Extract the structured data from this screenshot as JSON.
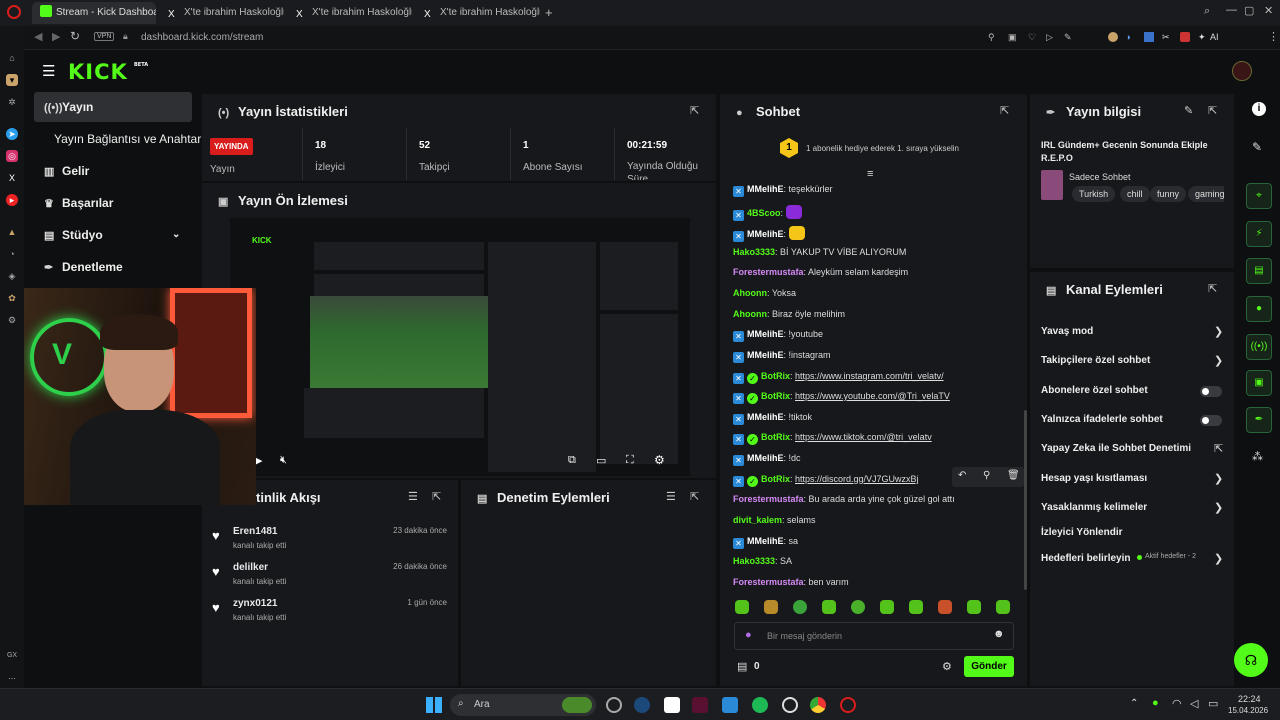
{
  "browser": {
    "tabs": [
      "Stream - Kick Dashboard",
      "X'te ibrahim Haskoloğlu: '",
      "X'te ibrahim Haskoloğlu: '",
      "X'te ibrahim Haskoloğlu: '"
    ],
    "new_tab": "+",
    "vpn": "VPN",
    "url": "dashboard.kick.com/stream",
    "ai": "AI"
  },
  "side_bar_bottom": {
    "gx": "GX",
    "more": "..."
  },
  "brand": {
    "logo": "KICK",
    "beta": "BETA"
  },
  "nav": {
    "items": [
      {
        "label": "Yayın",
        "icon": "broadcast-icon"
      },
      {
        "label": "Yayın Bağlantısı ve Anahtarı",
        "icon": ""
      },
      {
        "label": "Gelir",
        "icon": "chart-icon"
      },
      {
        "label": "Başarılar",
        "icon": "trophy-icon"
      },
      {
        "label": "Stüdyo",
        "icon": "studio-icon"
      },
      {
        "label": "Denetleme",
        "icon": "wrench-icon"
      }
    ]
  },
  "stats": {
    "title": "Yayın İstatistikleri",
    "live_badge": "YAYINDA",
    "live_label": "Yayın",
    "cells": [
      {
        "value": "18",
        "label": "İzleyici"
      },
      {
        "value": "52",
        "label": "Takipçi"
      },
      {
        "value": "1",
        "label": "Abone Sayısı"
      },
      {
        "value": "00:21:59",
        "label": "Yayında Olduğu Süre"
      }
    ]
  },
  "preview": {
    "title": "Yayın Ön İzlemesi"
  },
  "activity": {
    "title": "tinlik Akışı",
    "items": [
      {
        "name": "Eren1481",
        "action": "kanalı takip etti",
        "time": "23 dakika önce"
      },
      {
        "name": "delilker",
        "action": "kanalı takip etti",
        "time": "26 dakika önce"
      },
      {
        "name": "zynx0121",
        "action": "kanalı takip etti",
        "time": "1 gün önce"
      }
    ]
  },
  "mod_actions": {
    "title": "Denetim Eylemleri"
  },
  "chat": {
    "title": "Sohbet",
    "gift_rank": "1",
    "gift_banner": "1 abonelik hediye ederek 1. sıraya yükselin",
    "messages": [
      {
        "user": "MMelihE",
        "color": "#ffffff",
        "text": "teşekkürler",
        "badge": "kick",
        "link": false
      },
      {
        "user": "4BScoo",
        "color": "#53fc18",
        "text": "",
        "badge": "kick",
        "link": false
      },
      {
        "user": "MMelihE",
        "color": "#ffffff",
        "text": "",
        "badge": "kick",
        "link": false
      },
      {
        "user": "Hako3333",
        "color": "#53fc18",
        "text": "Bİ YAKUP TV VİBE ALIYORUM",
        "badge": "",
        "link": false
      },
      {
        "user": "Forestermustafa",
        "color": "#d58af5",
        "text": "Aleyküm selam kardeşim",
        "badge": "",
        "link": false
      },
      {
        "user": "Ahoonn",
        "color": "#53fc18",
        "text": "Yoksa",
        "badge": "",
        "link": false
      },
      {
        "user": "Ahoonn",
        "color": "#53fc18",
        "text": "Biraz öyle melihim",
        "badge": "",
        "link": false
      },
      {
        "user": "MMelihE",
        "color": "#ffffff",
        "text": "!youtube",
        "badge": "kick",
        "link": false
      },
      {
        "user": "MMelihE",
        "color": "#ffffff",
        "text": "!instagram",
        "badge": "kick",
        "link": false
      },
      {
        "user": "BotRix",
        "color": "#53fc18",
        "text": "https://www.instagram.com/tri_velatv/",
        "badge": "bot",
        "link": true
      },
      {
        "user": "BotRix",
        "color": "#53fc18",
        "text": "https://www.youtube.com/@Tri_velaTV",
        "badge": "bot",
        "link": true
      },
      {
        "user": "MMelihE",
        "color": "#ffffff",
        "text": "!tiktok",
        "badge": "kick",
        "link": false
      },
      {
        "user": "BotRix",
        "color": "#53fc18",
        "text": "https://www.tiktok.com/@tri_velatv",
        "badge": "bot",
        "link": true
      },
      {
        "user": "MMelihE",
        "color": "#ffffff",
        "text": "!dc",
        "badge": "kick",
        "link": false
      },
      {
        "user": "BotRix",
        "color": "#53fc18",
        "text": "https://discord.gg/VJ7GUwzxBj",
        "badge": "bot",
        "link": true
      },
      {
        "user": "Forestermustafa",
        "color": "#d58af5",
        "text": "Bu arada arda yine çok güzel gol attı",
        "badge": "",
        "link": false
      },
      {
        "user": "divit_kalem",
        "color": "#53fc18",
        "text": "selams",
        "badge": "",
        "link": false
      },
      {
        "user": "MMelihE",
        "color": "#ffffff",
        "text": "sa",
        "badge": "kick",
        "link": false
      },
      {
        "user": "Hako3333",
        "color": "#53fc18",
        "text": "SA",
        "badge": "",
        "link": false
      },
      {
        "user": "Forestermustafa",
        "color": "#d58af5",
        "text": "ben varım",
        "badge": "",
        "link": false
      }
    ],
    "input_placeholder": "Bir mesaj gönderin",
    "points": "0",
    "send": "Gönder"
  },
  "stream_info": {
    "title": "Yayın bilgisi",
    "stream_title": "IRL Gündem+ Gecenin Sonunda Ekiple R.E.P.O",
    "category": "Sadece Sohbet",
    "tags": [
      "Turkish",
      "chill",
      "funny",
      "gaming"
    ]
  },
  "channel_actions": {
    "title": "Kanal Eylemleri",
    "items": [
      {
        "label": "Yavaş mod",
        "control": "chevron"
      },
      {
        "label": "Takipçilere özel sohbet",
        "control": "chevron"
      },
      {
        "label": "Abonelere özel sohbet",
        "control": "toggle"
      },
      {
        "label": "Yalnızca ifadelerle sohbet",
        "control": "toggle"
      },
      {
        "label": "Yapay Zeka ile Sohbet Denetimi",
        "control": "external"
      },
      {
        "label": "Hesap yaşı kısıtlaması",
        "control": "chevron"
      },
      {
        "label": "Yasaklanmış kelimeler",
        "control": "chevron"
      },
      {
        "label": "İzleyici Yönlendir",
        "control": "none"
      },
      {
        "label": "Hedefleri belirleyin",
        "control": "chevron"
      }
    ],
    "goals_status": "Aktif hedefler - 2"
  },
  "taskbar": {
    "search": "Ara",
    "time": "22:24",
    "date": "15.04.2026"
  },
  "colors": {
    "accent": "#53fc18",
    "live": "#d91d1d",
    "panel": "#17181b",
    "bg": "#0e0f10"
  }
}
